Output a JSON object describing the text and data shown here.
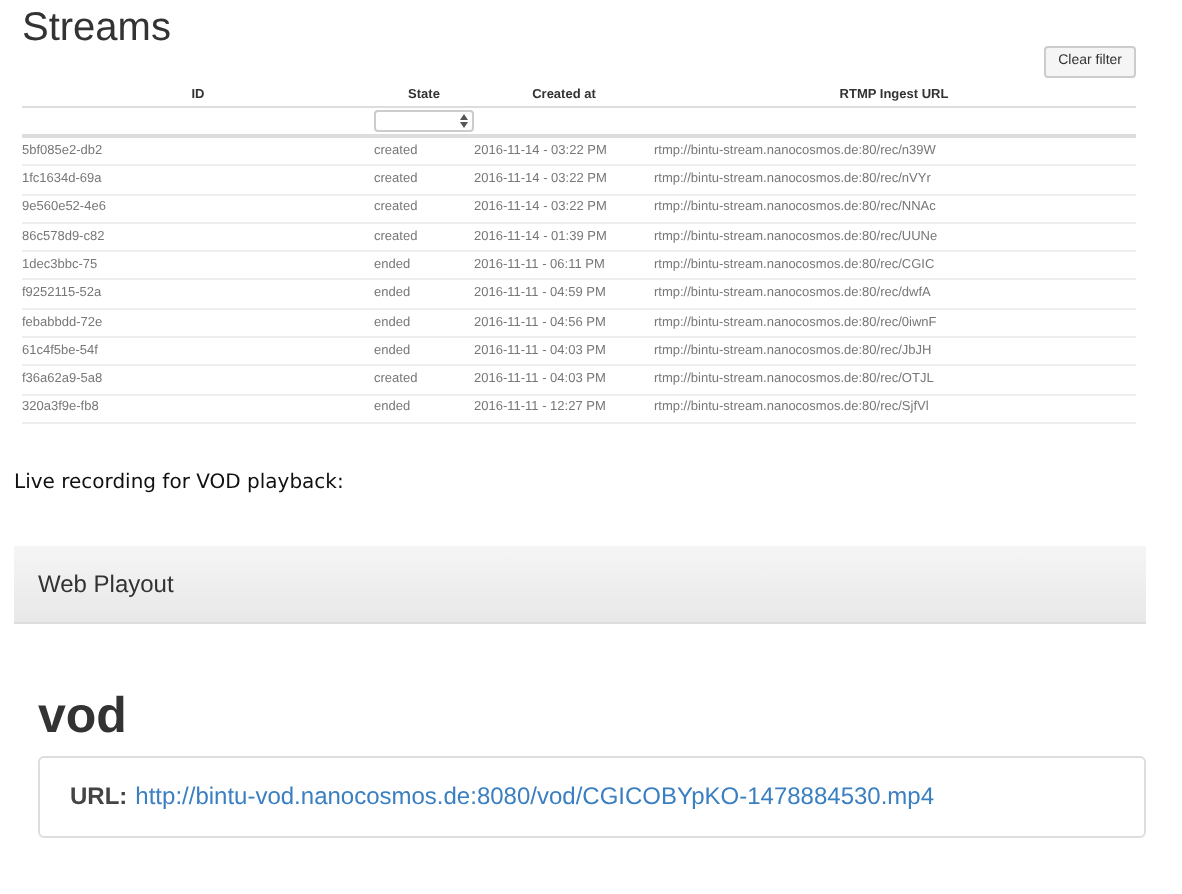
{
  "title": "Streams",
  "clear_filter": "Clear filter",
  "table": {
    "columns": [
      "ID",
      "State",
      "Created at",
      "RTMP Ingest URL"
    ],
    "rows": [
      {
        "id": "5bf085e2-db2",
        "state": "created",
        "created": "2016-11-14 - 03:22 PM",
        "url": "rtmp://bintu-stream.nanocosmos.de:80/rec/n39W"
      },
      {
        "id": "1fc1634d-69a",
        "state": "created",
        "created": "2016-11-14 - 03:22 PM",
        "url": "rtmp://bintu-stream.nanocosmos.de:80/rec/nVYr"
      },
      {
        "id": "9e560e52-4e6",
        "state": "created",
        "created": "2016-11-14 - 03:22 PM",
        "url": "rtmp://bintu-stream.nanocosmos.de:80/rec/NNAc"
      },
      {
        "id": "86c578d9-c82",
        "state": "created",
        "created": "2016-11-14 - 01:39 PM",
        "url": "rtmp://bintu-stream.nanocosmos.de:80/rec/UUNe"
      },
      {
        "id": "1dec3bbc-75",
        "state": "ended",
        "created": "2016-11-11 - 06:11 PM",
        "url": "rtmp://bintu-stream.nanocosmos.de:80/rec/CGIC"
      },
      {
        "id": "f9252115-52a",
        "state": "ended",
        "created": "2016-11-11 - 04:59 PM",
        "url": "rtmp://bintu-stream.nanocosmos.de:80/rec/dwfA"
      },
      {
        "id": "febabbdd-72e",
        "state": "ended",
        "created": "2016-11-11 - 04:56 PM",
        "url": "rtmp://bintu-stream.nanocosmos.de:80/rec/0iwnF"
      },
      {
        "id": "61c4f5be-54f",
        "state": "ended",
        "created": "2016-11-11 - 04:03 PM",
        "url": "rtmp://bintu-stream.nanocosmos.de:80/rec/JbJH"
      },
      {
        "id": "f36a62a9-5a8",
        "state": "created",
        "created": "2016-11-11 - 04:03 PM",
        "url": "rtmp://bintu-stream.nanocosmos.de:80/rec/OTJL"
      },
      {
        "id": "320a3f9e-fb8",
        "state": "ended",
        "created": "2016-11-11 - 12:27 PM",
        "url": "rtmp://bintu-stream.nanocosmos.de:80/rec/SjfVl"
      }
    ]
  },
  "intro": "Live recording for VOD playback:",
  "panel_title": "Web Playout",
  "vod_heading": "vod",
  "url_label": "URL:",
  "url": "http://bintu-vod.nanocosmos.de:8080/vod/CGICOBYpKO-1478884530.mp4"
}
